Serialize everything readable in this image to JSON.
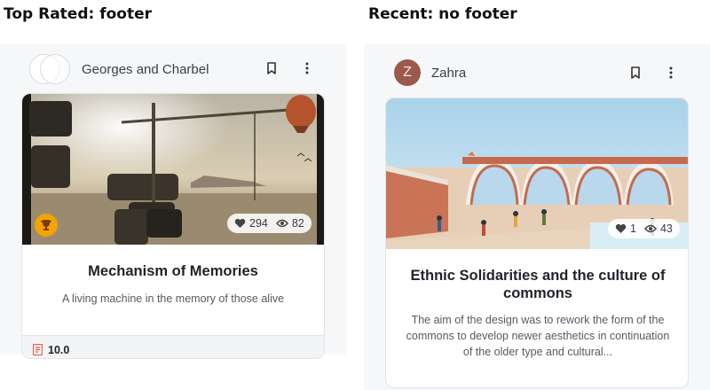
{
  "labels": {
    "left_title": "Top Rated: footer",
    "right_title": "Recent: no footer"
  },
  "left_card": {
    "author": "Georges and Charbel",
    "likes": "294",
    "views": "82",
    "title": "Mechanism of Memories",
    "description": "A living machine in the memory of those alive",
    "footer_value": "10.0",
    "badge_icon": "trophy-icon",
    "accent_color": "#f5a300"
  },
  "right_card": {
    "author_initial": "Z",
    "author": "Zahra",
    "likes": "1",
    "views": "43",
    "title": "Ethnic Solidarities and the culture of commons",
    "description": "The aim of the design was to rework the form of the commons to develop newer aesthetics in continuation of the older type and cultural...",
    "avatar_color": "#9b5a4a"
  },
  "icons": {
    "bookmark": "bookmark-icon",
    "more": "more-vertical-icon",
    "heart": "heart-icon",
    "eye": "eye-icon",
    "score": "score-icon"
  }
}
